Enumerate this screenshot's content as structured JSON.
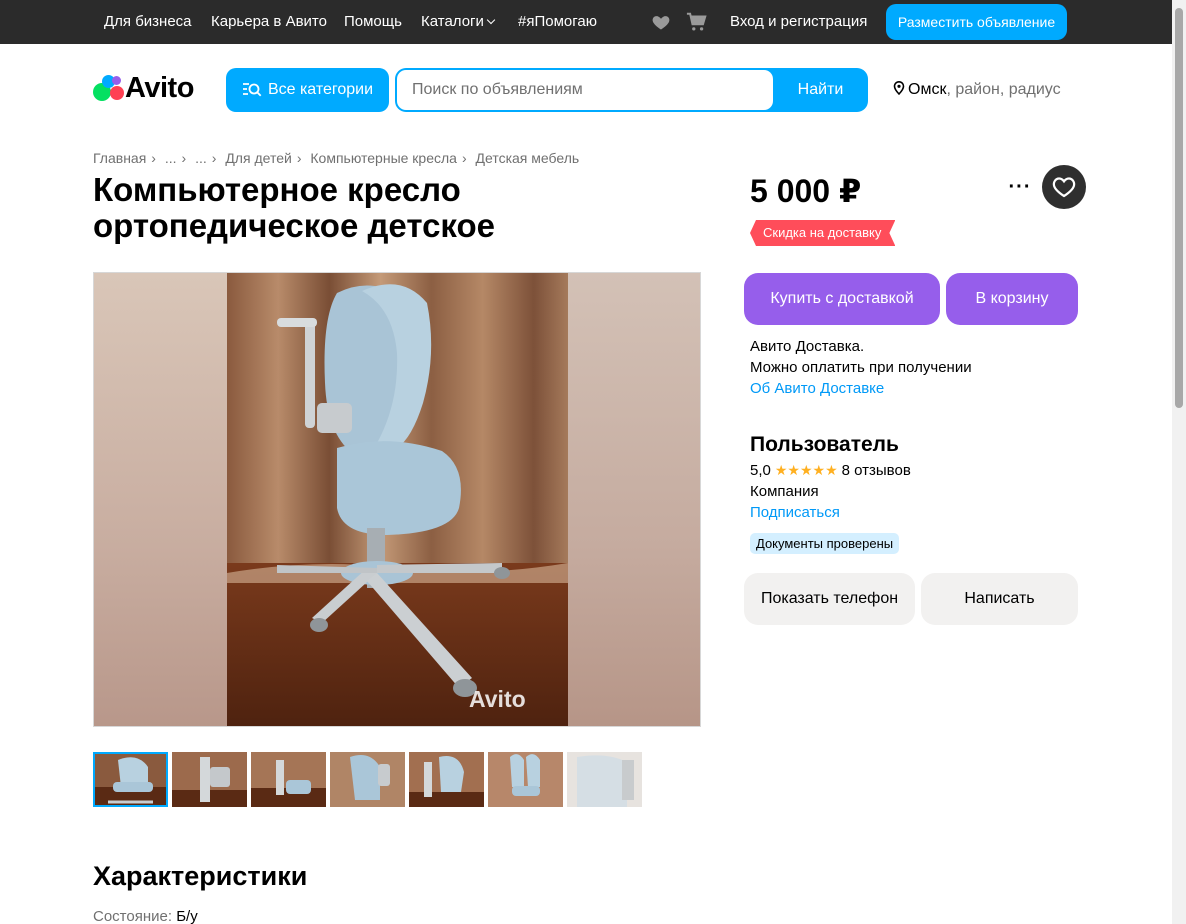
{
  "topbar": {
    "links": [
      "Для бизнеса",
      "Карьера в Авито",
      "Помощь",
      "Каталоги",
      "#яПомогаю"
    ],
    "login": "Вход и регистрация",
    "post_button": "Разместить объявление"
  },
  "header": {
    "logo_text": "Avito",
    "categories_button": "Все категории",
    "search_placeholder": "Поиск по объявлениям",
    "search_button": "Найти",
    "location_city": "Омск",
    "location_rest": ", район, радиус"
  },
  "breadcrumb": [
    "Главная",
    "...",
    "...",
    "Для детей",
    "Компьютерные кресла",
    "Детская мебель"
  ],
  "listing": {
    "title": "Компьютерное кресло ортопедическое детское",
    "price": "5 000 ₽",
    "discount_badge": "Скидка на доставку",
    "watermark": "Avito",
    "thumbnail_count": 7
  },
  "actions": {
    "buy_delivery": "Купить с доставкой",
    "to_cart": "В корзину",
    "more": "···",
    "show_phone": "Показать телефон",
    "write": "Написать"
  },
  "delivery": {
    "line1": "Авито Доставка.",
    "line2": "Можно оплатить при получении",
    "link": "Об Авито Доставке"
  },
  "seller": {
    "name": "Пользователь",
    "rating": "5,0",
    "stars": "★★★★★",
    "reviews": "8 отзывов",
    "type": "Компания",
    "subscribe": "Подписаться",
    "verified_badge": "Документы проверены"
  },
  "characteristics": {
    "heading": "Характеристики",
    "items": [
      {
        "label": "Состояние:",
        "value": "Б/у"
      }
    ]
  },
  "colors": {
    "accent_blue": "#00aaff",
    "purple": "#965eeb",
    "discount_red": "#ff4d5a",
    "link_blue": "#0099f7"
  }
}
